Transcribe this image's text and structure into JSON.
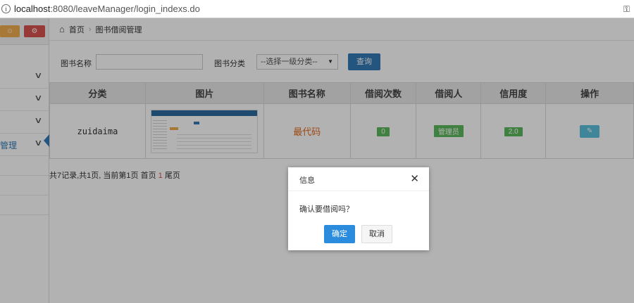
{
  "browser": {
    "url_host": "localhost",
    "url_rest": ":8080/leaveManager/login_indexs.do",
    "info_icon": "i",
    "key_icon": "key-icon"
  },
  "sidebar": {
    "items": [
      {
        "label": ""
      },
      {
        "label": ""
      },
      {
        "label": ""
      },
      {
        "label": "管理"
      }
    ]
  },
  "breadcrumb": {
    "home": "首页",
    "current": "图书借阅管理"
  },
  "search": {
    "name_label": "图书名称",
    "name_value": "",
    "category_label": "图书分类",
    "category_selected": "--选择一级分类--",
    "query_button": "查询"
  },
  "table": {
    "headers": [
      "分类",
      "图片",
      "图书名称",
      "借阅次数",
      "借阅人",
      "信用度",
      "操作"
    ],
    "rows": [
      {
        "category": "zuidaima",
        "book_name": "最代码",
        "borrow_count": "0",
        "borrower": "管理员",
        "credit": "2.0"
      }
    ]
  },
  "pager": {
    "prefix": "共7记录,共1页, 当前第1页 首页 ",
    "current": "1",
    "suffix": " 尾页"
  },
  "dialog": {
    "title": "信息",
    "message": "确认要借阅吗？",
    "ok": "确定",
    "cancel": "取消"
  },
  "colors": {
    "primary": "#337ab7",
    "success": "#5cb85c",
    "info": "#5bc0de",
    "danger": "#d9534f",
    "warning": "#f0ad4e"
  }
}
